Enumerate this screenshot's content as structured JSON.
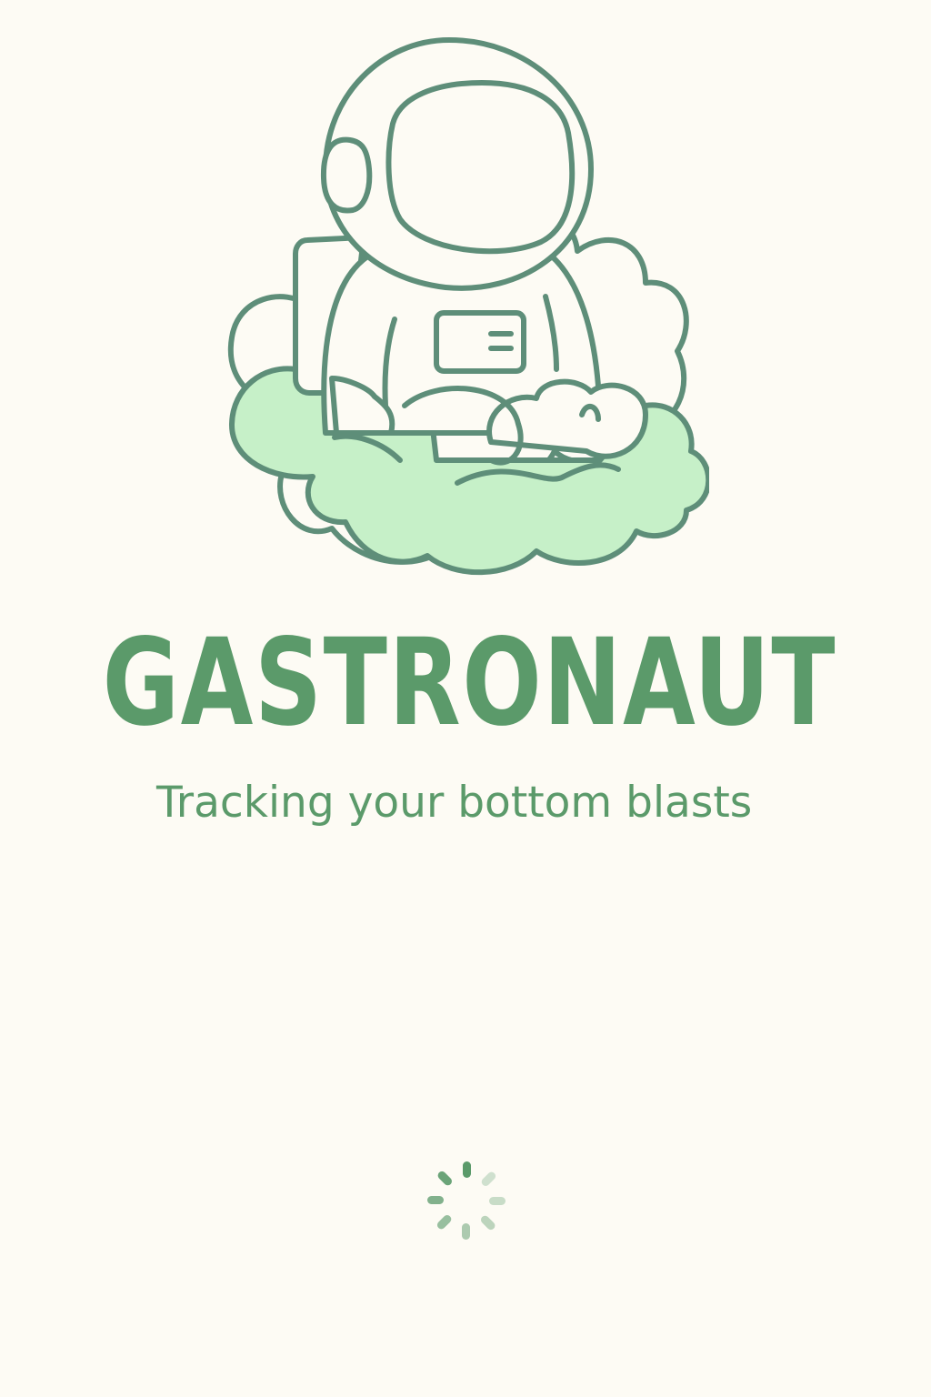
{
  "app": {
    "title": "GASTRONAUT",
    "tagline": "Tracking your bottom blasts"
  },
  "logo": {
    "icon": "astronaut-on-cloud-icon"
  },
  "loading": {
    "icon": "loading-spinner-icon"
  },
  "colors": {
    "background": "#fdfbf4",
    "brand_green": "#5b9a6a",
    "outline": "#5e8e79",
    "cloud_fill": "#c6f0c8"
  }
}
